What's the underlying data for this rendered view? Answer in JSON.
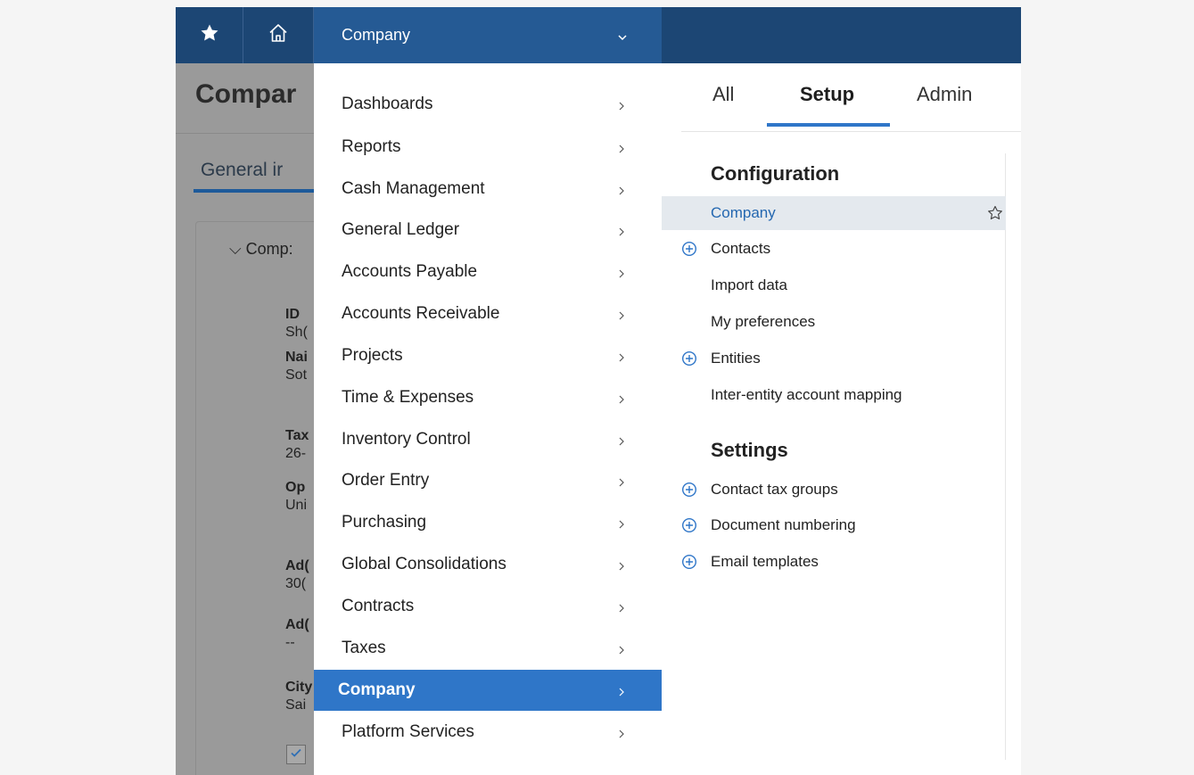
{
  "topbar": {
    "star_icon": "star-icon",
    "home_icon": "home-icon",
    "menu_trigger_label": "Company",
    "colors": {
      "bar": "#1c4674",
      "trigger": "#255a94"
    }
  },
  "background_page": {
    "title": "Compar",
    "section_tab": "General ir",
    "group_label": "Comp:",
    "fields": [
      {
        "label": "ID",
        "value": "Sh("
      },
      {
        "label": "Nai",
        "value": "Sot"
      },
      {
        "label": "Tax",
        "value": "26-"
      },
      {
        "label": "Op",
        "value": "Uni"
      },
      {
        "label": "Ad(",
        "value": "30("
      },
      {
        "label": "Ad(",
        "value": "--"
      },
      {
        "label": "City",
        "value": "Sai"
      }
    ]
  },
  "main_menu": {
    "items": [
      {
        "label": "Dashboards"
      },
      {
        "label": "Reports"
      },
      {
        "label": "Cash Management"
      },
      {
        "label": "General Ledger"
      },
      {
        "label": "Accounts Payable"
      },
      {
        "label": "Accounts Receivable"
      },
      {
        "label": "Projects"
      },
      {
        "label": "Time & Expenses"
      },
      {
        "label": "Inventory Control"
      },
      {
        "label": "Order Entry"
      },
      {
        "label": "Purchasing"
      },
      {
        "label": "Global Consolidations"
      },
      {
        "label": "Contracts"
      },
      {
        "label": "Taxes"
      },
      {
        "label": "Company",
        "active": true
      },
      {
        "label": "Platform Services"
      }
    ],
    "active_color": "#2f76c8"
  },
  "submenu": {
    "tabs": [
      {
        "label": "All"
      },
      {
        "label": "Setup",
        "active": true
      },
      {
        "label": "Admin"
      }
    ],
    "sections": [
      {
        "title": "Configuration",
        "items": [
          {
            "label": "Company",
            "selected": true,
            "favorite_icon": "star-outline-icon"
          },
          {
            "label": "Contacts",
            "add_icon": "plus-circle-icon"
          },
          {
            "label": "Import data"
          },
          {
            "label": "My preferences"
          },
          {
            "label": "Entities",
            "add_icon": "plus-circle-icon"
          },
          {
            "label": "Inter-entity account mapping"
          }
        ]
      },
      {
        "title": "Settings",
        "items": [
          {
            "label": "Contact tax groups",
            "add_icon": "plus-circle-icon"
          },
          {
            "label": "Document numbering",
            "add_icon": "plus-circle-icon"
          },
          {
            "label": "Email templates",
            "add_icon": "plus-circle-icon"
          }
        ]
      }
    ],
    "link_color": "#2467b0"
  }
}
